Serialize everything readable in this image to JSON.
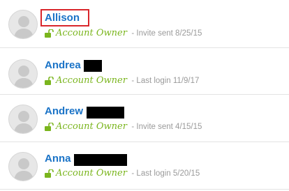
{
  "users": [
    {
      "name": "Allison",
      "role": "Account Owner",
      "status": "- Invite sent 8/25/15"
    },
    {
      "name": "Andrea",
      "role": "Account Owner",
      "status": "- Last login 11/9/17"
    },
    {
      "name": "Andrew",
      "role": "Account Owner",
      "status": "- Invite sent 4/15/15"
    },
    {
      "name": "Anna",
      "role": "Account Owner",
      "status": "- Last login 5/20/15"
    }
  ],
  "icons": {
    "avatar": "default-user-avatar-icon",
    "lock": "unlocked-padlock-icon"
  },
  "colors": {
    "name_link": "#1a73c7",
    "role_label": "#7ab51d",
    "status_text": "#9a9a9a",
    "highlight_box": "#d9262b",
    "divider": "#e3e3e3"
  }
}
